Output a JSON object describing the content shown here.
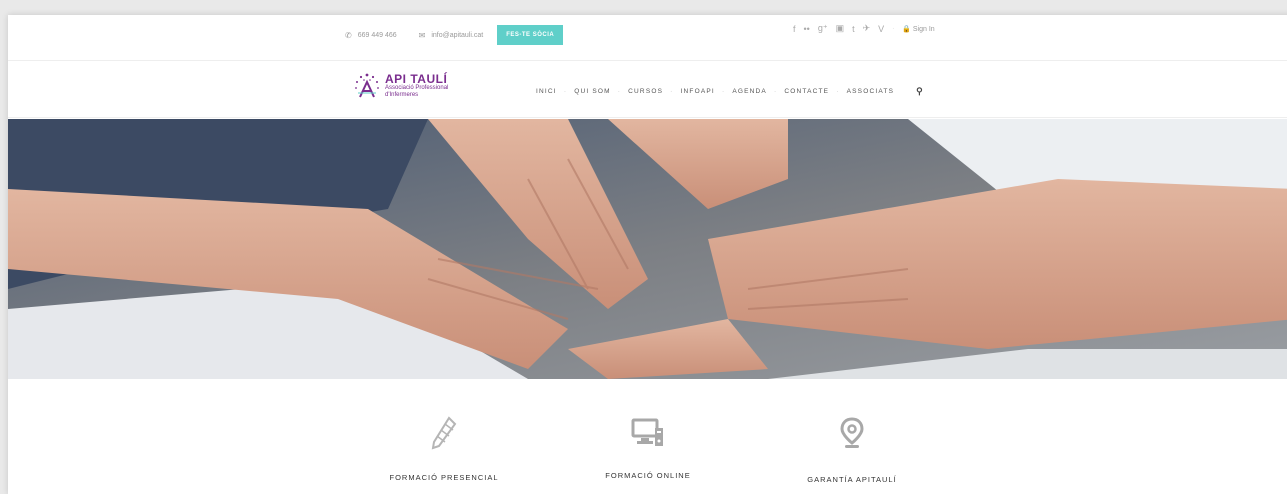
{
  "topbar": {
    "phone": "669 449 466",
    "email": "info@apitauli.cat",
    "join_button": "FES-TE SÒCIA",
    "social_icons": [
      "facebook-icon",
      "flickr-icon",
      "googleplus-icon",
      "linkedin-icon",
      "tumblr-icon",
      "twitter-icon",
      "vimeo-icon"
    ],
    "signin": "Sign In"
  },
  "logo": {
    "title": "API TAULÍ",
    "line1": "Associació Professional",
    "line2": "d'Infermeres",
    "color": "#7a2d8e"
  },
  "nav": {
    "items": [
      "INICI",
      "QUI SOM",
      "CURSOS",
      "INFOAPI",
      "AGENDA",
      "CONTACTE",
      "ASSOCIATS"
    ]
  },
  "features": [
    {
      "label": "FORMACIÓ PRESENCIAL",
      "icon": "pencil-icon"
    },
    {
      "label": "FORMACIÓ ONLINE",
      "icon": "computer-icon"
    },
    {
      "label": "GARANTÍA APITAULÍ",
      "icon": "location-pin-icon"
    }
  ],
  "colors": {
    "accent": "#5fcfc9",
    "brand": "#7a2d8e"
  }
}
